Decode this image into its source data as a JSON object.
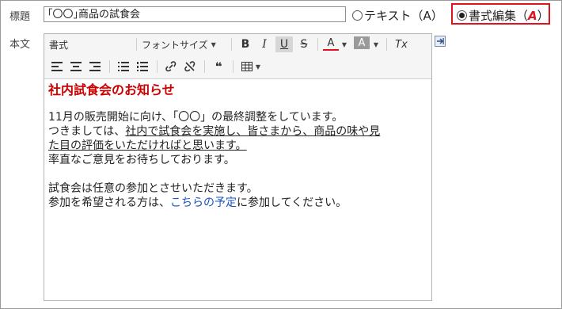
{
  "labels": {
    "title": "標題",
    "body": "本文"
  },
  "title_value": "｢〇〇｣商品の試食会",
  "radio_text": {
    "label": "テキスト（A）",
    "selected": false
  },
  "radio_rich": {
    "label_prefix": "書式編集（",
    "label_mark": "A",
    "label_suffix": "）",
    "selected": true
  },
  "toolbar": {
    "format_select": "書式",
    "fontsize_select": "フォントサイズ",
    "bold": "B",
    "italic": "I",
    "underline": "U",
    "strike": "S",
    "text_color": "A",
    "bg_color": "A",
    "clear_format": "Tx",
    "quote": "66"
  },
  "content": {
    "heading": "社内試食会のお知らせ",
    "p1_line1": "11月の販売開始に向け、「〇〇」の最終調整をしています。",
    "p1_line2_pre": "つきましては、",
    "p1_line2_u": "社内で試食会を実施し、皆さまから、商品の味や見",
    "p1_line3_u": "た目の評価をいただければと思います。",
    "p1_line4": "率直なご意見をお待ちしております。",
    "p2_line1": "試食会は任意の参加とさせいただきます。",
    "p2_line2_pre": "参加を希望される方は、",
    "p2_link": "こちらの予定",
    "p2_line2_post": "に参加してください。"
  },
  "colors": {
    "highlight": "#e0141e",
    "heading": "#cc0000",
    "link": "#1a55c0"
  }
}
